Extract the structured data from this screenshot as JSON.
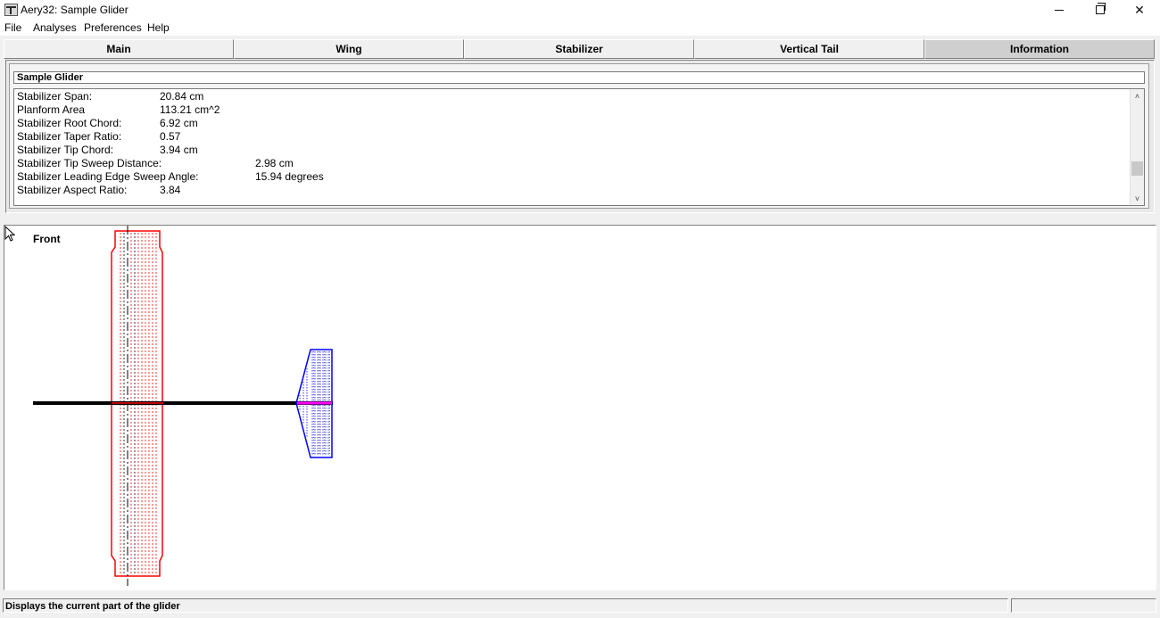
{
  "window": {
    "title": "Aery32:  Sample Glider",
    "minimize_glyph": "—",
    "close_glyph": "✕"
  },
  "menu": {
    "items": [
      {
        "label": "File"
      },
      {
        "label": "Analyses"
      },
      {
        "label": "Preferences"
      },
      {
        "label": "Help"
      }
    ]
  },
  "tabs": [
    {
      "label": "Main",
      "active": false
    },
    {
      "label": "Wing",
      "active": false
    },
    {
      "label": "Stabilizer",
      "active": false
    },
    {
      "label": "Vertical Tail",
      "active": false
    },
    {
      "label": "Information",
      "active": true
    }
  ],
  "info": {
    "glider_name": "Sample Glider",
    "rows": [
      {
        "label": "Stabilizer Span:",
        "value": "20.84 cm"
      },
      {
        "label": "Planform Area",
        "value": "113.21  cm^2"
      },
      {
        "label": "Stabilizer Root Chord:",
        "value": "6.92 cm"
      },
      {
        "label": "Stabilizer Taper Ratio:",
        "value": "0.57"
      },
      {
        "label": "Stabilizer Tip Chord:",
        "value": "3.94 cm"
      },
      {
        "label": "Stabilizer Tip Sweep Distance:",
        "value": "2.98  cm"
      },
      {
        "label": "Stabilizer Leading Edge Sweep Angle:",
        "value": "15.94 degrees"
      },
      {
        "label": "Stabilizer Aspect Ratio:",
        "value": "3.84"
      }
    ]
  },
  "drawing": {
    "view_label": "Front",
    "colors": {
      "wing": "#ff0000",
      "stabilizer": "#0000ff",
      "fuselage": "#000000",
      "highlight": "#ff00ff"
    }
  },
  "status": {
    "text": "Displays the current part of the glider"
  }
}
